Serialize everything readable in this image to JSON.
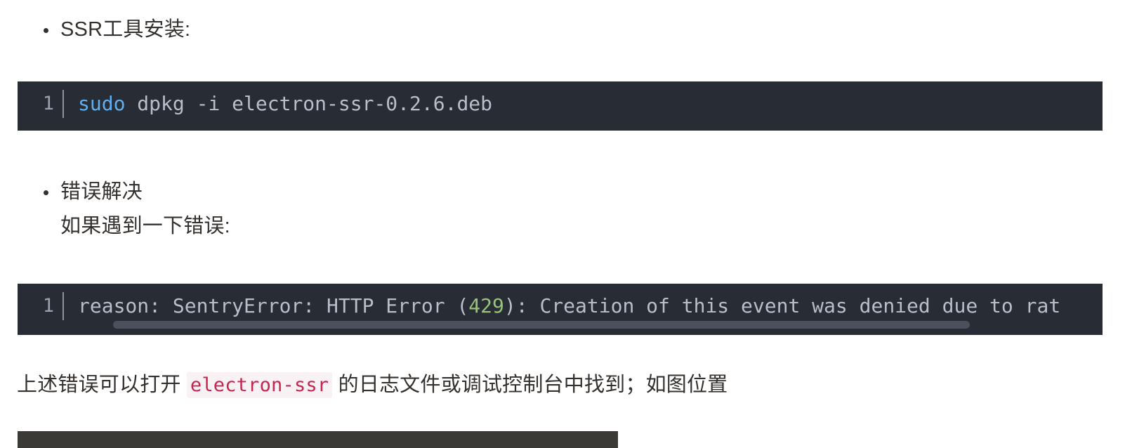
{
  "document": {
    "sections": [
      {
        "bullet": "SSR工具安装:",
        "code": {
          "line_number": "1",
          "parts": [
            {
              "text": "sudo",
              "token": "keyword"
            },
            {
              "text": " dpkg -i electron-ssr-0.2.6.deb",
              "token": "plain"
            }
          ]
        }
      },
      {
        "bullet": "错误解决",
        "sub_line": "如果遇到一下错误:",
        "code": {
          "line_number": "1",
          "parts": [
            {
              "text": "reason: SentryError: HTTP Error (",
              "token": "plain"
            },
            {
              "text": "429",
              "token": "number"
            },
            {
              "text": "): Creation of this event was denied due to rat",
              "token": "plain"
            }
          ]
        }
      }
    ],
    "paragraph": {
      "before": "上述错误可以打开 ",
      "inline_code": "electron-ssr",
      "after": " 的日志文件或调试控制台中找到；如图位置"
    }
  },
  "code_text": {
    "block1_full": "sudo dpkg -i electron-ssr-0.2.6.deb",
    "block1_prefix": "sudo",
    "block1_rest": " dpkg -i electron-ssr-0.2.6.deb",
    "block2_pre": "reason: SentryError: HTTP Error (",
    "block2_number": "429",
    "block2_post": "): Creation of this event was denied due to rat",
    "line_number": "1"
  },
  "colors": {
    "code_background": "#282c34",
    "code_foreground": "#b9bfca",
    "keyword": "#61aeee",
    "number": "#98c379",
    "gutter": "#9aa0ae",
    "inline_code_text": "#c7254e",
    "inline_code_background": "#f9f2f4",
    "body_text": "#34302d",
    "scrollbar_thumb": "#4a505c",
    "bottom_bar": "#3b3a36"
  }
}
